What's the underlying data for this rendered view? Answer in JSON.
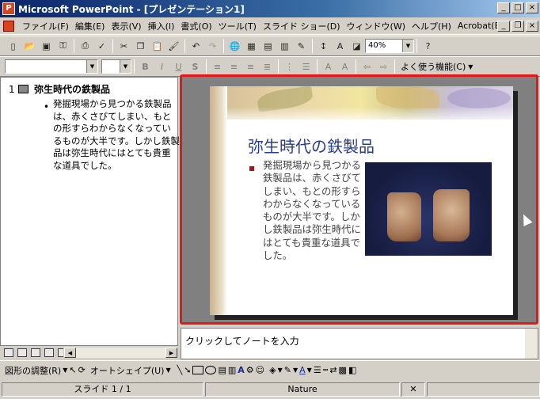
{
  "window": {
    "title": "Microsoft PowerPoint - [プレゼンテーション1]",
    "controls": [
      "_",
      "□",
      "×"
    ]
  },
  "menubar": {
    "items": [
      "ファイル(F)",
      "編集(E)",
      "表示(V)",
      "挿入(I)",
      "書式(O)",
      "ツール(T)",
      "スライド ショー(D)",
      "ウィンドウ(W)",
      "ヘルプ(H)",
      "Acrobat(B)"
    ],
    "doc_controls": [
      "_",
      "❐",
      "×"
    ]
  },
  "toolbar_standard": {
    "zoom": "40%",
    "help": "?"
  },
  "toolbar_formatting": {
    "font_name": "",
    "font_size": "",
    "bold": "B",
    "italic": "I",
    "underline": "U",
    "shadow": "S",
    "frequent_label": "よく使う機能(C)"
  },
  "outline": {
    "slide_number": "1",
    "slide_title": "弥生時代の鉄製品",
    "bullet": "•",
    "body_text": "発掘現場から見つかる鉄製品は、赤くさびてしまい、もとの形すらわからなくなっているものが大半です。しかし鉄製品は弥生時代にはとても貴重な道具でした。"
  },
  "slide": {
    "title": "弥生時代の鉄製品",
    "body_text": "発掘現場から見つかる鉄製品は、赤くさびてしまい、もとの形すらわからなくなっているものが大半です。しかし鉄製品は弥生時代にはとても貴重な道具でした。"
  },
  "notes": {
    "placeholder": "クリックしてノートを入力"
  },
  "draw_toolbar": {
    "adjust_label": "図形の調整(R)",
    "autoshape_label": "オートシェイプ(U)"
  },
  "statusbar": {
    "slide_label": "スライド 1 / 1",
    "design": "Nature"
  },
  "colors": {
    "accent_red": "#e01818",
    "title_blue": "#283c8c"
  }
}
